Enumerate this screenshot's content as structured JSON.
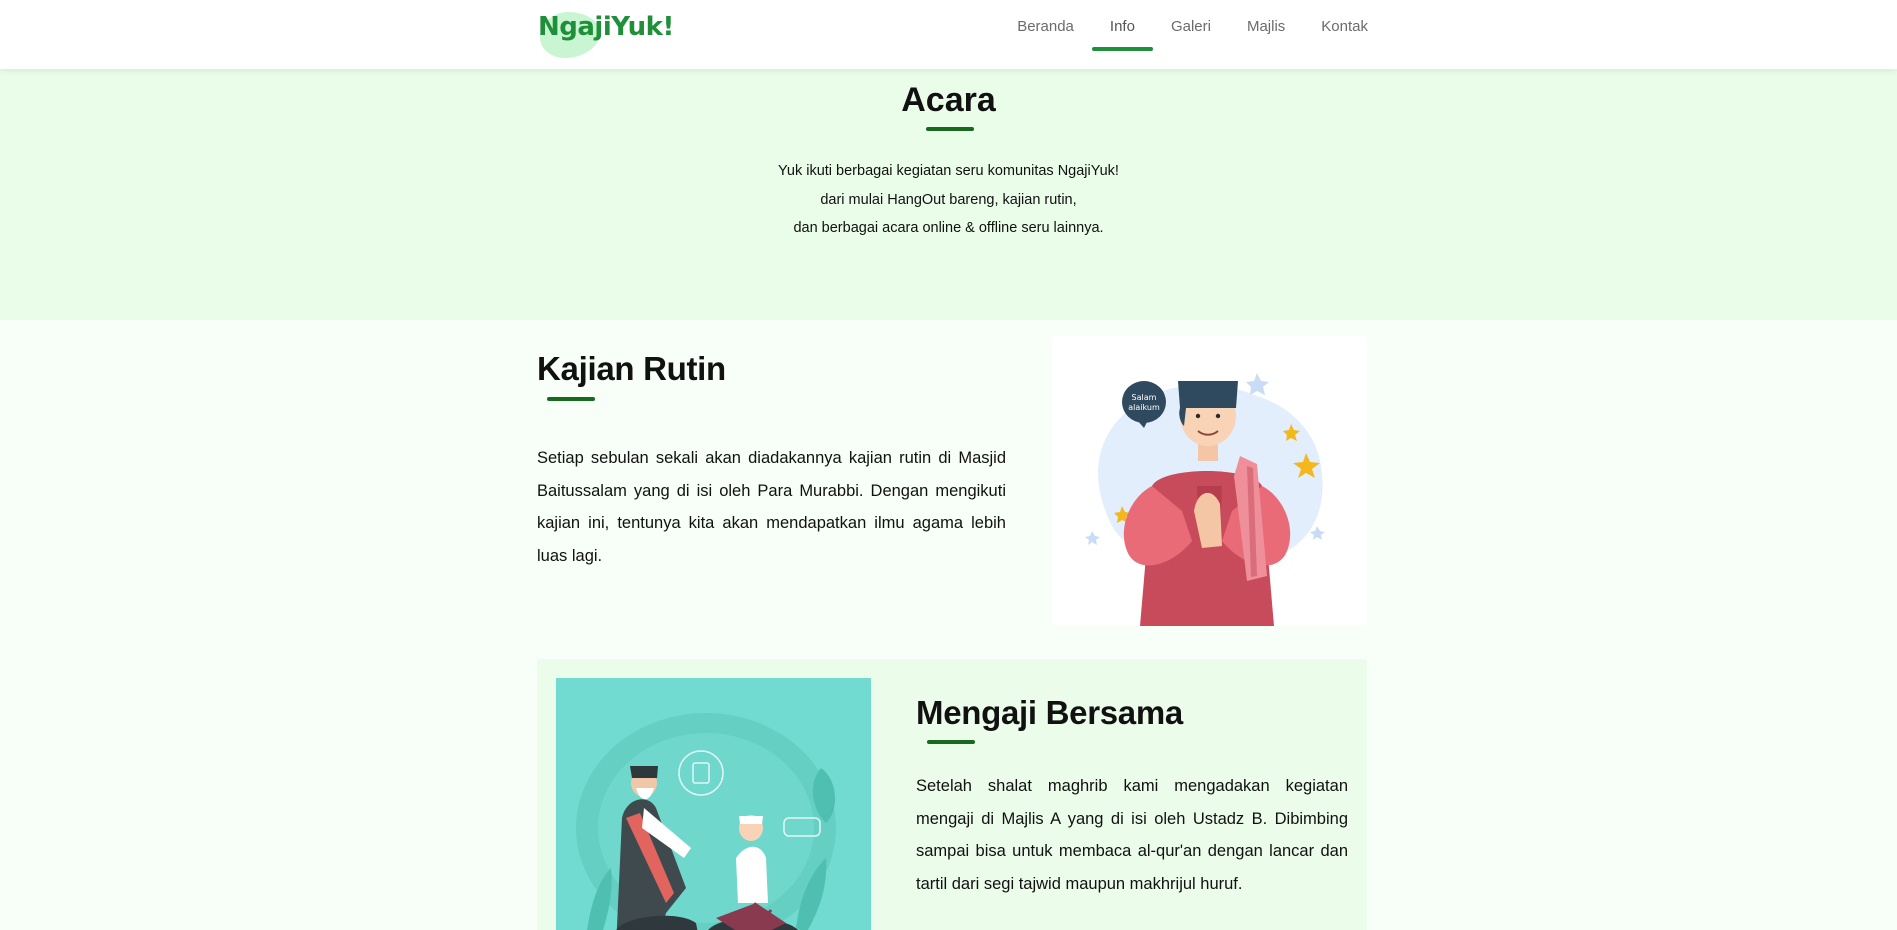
{
  "brand": {
    "logo_text": "NgajiYuk!"
  },
  "nav": {
    "items": [
      "Beranda",
      "Info",
      "Galeri",
      "Majlis",
      "Kontak"
    ],
    "active": "Info"
  },
  "hero": {
    "title": "Acara",
    "lines": [
      "Yuk ikuti berbagai kegiatan seru komunitas NgajiYuk!",
      "dari mulai HangOut bareng, kajian rutin,",
      "dan berbagai acara online & offline seru lainnya."
    ]
  },
  "kajian": {
    "title": "Kajian Rutin",
    "text": "Setiap sebulan sekali akan diadakannya kajian rutin di Masjid Baitussalam yang di isi oleh Para Murabbi. Dengan mengikuti kajian ini, tentunya kita akan mendapatkan ilmu agama lebih luas lagi.",
    "image": {
      "speech_bubble": "Salam alaikum"
    }
  },
  "mengaji": {
    "title": "Mengaji Bersama",
    "text": "Setelah shalat maghrib kami mengadakan kegiatan mengaji di Majlis A yang di isi oleh Ustadz B. Dibimbing sampai bisa untuk membaca al-qur'an dengan lancar dan tartil dari segi tajwid maupun makhrijul huruf."
  },
  "colors": {
    "brand_green": "#1f8f3a",
    "underline_green": "#17691f",
    "hero_bg": "#e9fde8",
    "page_bg": "#f7fff8",
    "card_bg": "#ebfdea",
    "teal_illustration": "#72dbd1"
  }
}
